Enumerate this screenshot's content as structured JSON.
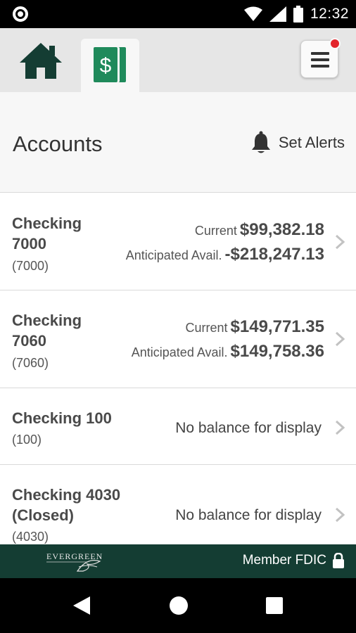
{
  "status_bar": {
    "time": "12:32"
  },
  "nav": {
    "home_icon": "home-icon",
    "accounts_icon": "money-stack-icon",
    "menu_icon": "hamburger-menu-icon"
  },
  "header": {
    "title": "Accounts",
    "alerts_label": "Set Alerts"
  },
  "accounts": [
    {
      "name_line1": "Checking",
      "name_line2": "7000",
      "number": "(7000)",
      "current_label": "Current",
      "current_value": "$99,382.18",
      "anticipated_label": "Anticipated Avail.",
      "anticipated_value": "-$218,247.13"
    },
    {
      "name_line1": "Checking",
      "name_line2": "7060",
      "number": "(7060)",
      "current_label": "Current",
      "current_value": "$149,771.35",
      "anticipated_label": "Anticipated Avail.",
      "anticipated_value": "$149,758.36"
    },
    {
      "name_line1": "Checking 100",
      "number": "(100)",
      "no_balance": "No balance for display"
    },
    {
      "name_line1": "Checking 4030",
      "name_line2": "(Closed)",
      "number": "(4030)",
      "no_balance": "No balance for display"
    }
  ],
  "footer": {
    "logo_text": "EVERGREEN",
    "fdic_label": "Member FDIC"
  },
  "colors": {
    "brand_dark": "#143d33",
    "brand_green": "#1f8a5b",
    "badge_red": "#e3242b"
  }
}
